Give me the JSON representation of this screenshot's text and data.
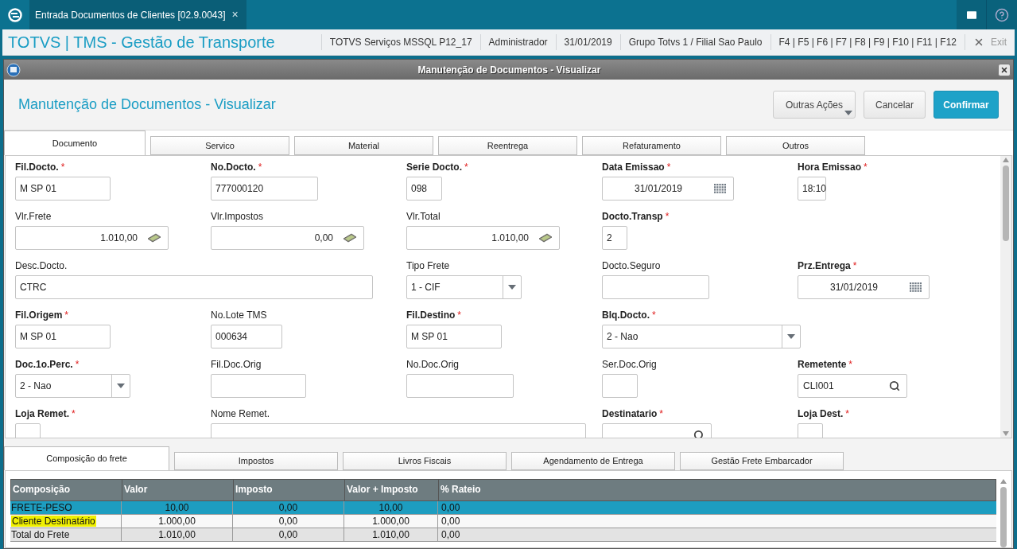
{
  "app_tab": {
    "title": "Entrada Documentos de Clientes [02.9.0043]",
    "close": "×"
  },
  "app_title": "TOTVS | TMS - Gestão de Transporte",
  "info": [
    "TOTVS Serviços MSSQL P12_17",
    "Administrador",
    "31/01/2019",
    "Grupo Totvs 1 / Filial Sao Paulo",
    "F4 | F5 | F6 | F7 | F8 | F9 | F10 | F11 | F12"
  ],
  "exit": "Exit",
  "dialog": {
    "title": "Manutenção de Documentos - Visualizar",
    "heading": "Manutenção de Documentos - Visualizar",
    "buttons": [
      {
        "label": "Outras Ações",
        "kind": "menu"
      },
      {
        "label": "Cancelar",
        "kind": "default"
      },
      {
        "label": "Confirmar",
        "kind": "primary"
      }
    ]
  },
  "tabs": [
    {
      "label": "Documento",
      "selected": true
    },
    {
      "label": "Servico",
      "selected": false
    },
    {
      "label": "Material",
      "selected": false
    },
    {
      "label": "Reentrega",
      "selected": false
    },
    {
      "label": "Refaturamento",
      "selected": false
    },
    {
      "label": "Outros",
      "selected": false
    }
  ],
  "fields": [
    {
      "label": "Fil.Docto.",
      "mark": "*",
      "value": "M SP 01",
      "kind": "text"
    },
    {
      "label": "No.Docto.",
      "mark": "*",
      "value": "777000120",
      "kind": "text"
    },
    {
      "label": "Serie Docto.",
      "mark": "*",
      "value": "098",
      "kind": "text"
    },
    {
      "label": "Data Emissao",
      "mark": "*",
      "value": "31/01/2019",
      "kind": "date"
    },
    {
      "label": "Hora Emissao",
      "mark": "*",
      "value": "18:10",
      "kind": "text"
    },
    {
      "label": "Vlr.Frete",
      "value": "1.010,00",
      "kind": "money"
    },
    {
      "label": "Vlr.Impostos",
      "value": "0,00",
      "kind": "money"
    },
    {
      "label": "Vlr.Total",
      "value": "1.010,00",
      "kind": "money"
    },
    {
      "label": "Docto.Transp",
      "mark": "*",
      "value": "2",
      "kind": "text"
    },
    {
      "label": "Desc.Docto.",
      "value": "CTRC",
      "kind": "text"
    },
    {
      "label": "Tipo Frete",
      "value": "1 - CIF",
      "kind": "select"
    },
    {
      "label": "Docto.Seguro",
      "kind": "text"
    },
    {
      "label": "Prz.Entrega",
      "mark": "*",
      "value": "31/01/2019",
      "kind": "date"
    },
    {
      "label": "Fil.Origem",
      "mark": "*",
      "value": "M SP 01",
      "kind": "text"
    },
    {
      "label": "No.Lote TMS",
      "value": "000634",
      "kind": "text"
    },
    {
      "label": "Fil.Destino",
      "mark": "*",
      "value": "M SP 01",
      "kind": "text"
    },
    {
      "label": "Blq.Docto.",
      "mark": "*",
      "value": "2 - Nao",
      "kind": "select"
    },
    {
      "label": "Doc.1o.Perc.",
      "mark": "*",
      "value": "2 - Nao",
      "kind": "select"
    },
    {
      "label": "Fil.Doc.Orig",
      "kind": "text"
    },
    {
      "label": "No.Doc.Orig",
      "kind": "text"
    },
    {
      "label": "Ser.Doc.Orig",
      "kind": "text"
    },
    {
      "label": "Remetente",
      "mark": "*",
      "value": "CLI001",
      "kind": "lookup"
    },
    {
      "label": "Loja Remet.",
      "mark": "*",
      "kind": "text"
    },
    {
      "label": "Nome Remet.",
      "kind": "text"
    },
    {
      "label": "Destinatario",
      "mark": "*",
      "kind": "lookup"
    },
    {
      "label": "Loja Dest.",
      "mark": "*",
      "kind": "text"
    }
  ],
  "bottom_tabs": [
    {
      "label": "Composição do frete",
      "selected": true
    },
    {
      "label": "Impostos",
      "selected": false
    },
    {
      "label": "Livros Fiscais",
      "selected": false
    },
    {
      "label": "Agendamento de Entrega",
      "selected": false
    },
    {
      "label": "Gestão Frete Embarcador",
      "selected": false
    }
  ],
  "table": {
    "columns": [
      "Composição",
      "Valor",
      "Imposto",
      "Valor + Imposto",
      "% Rateio"
    ],
    "rows": [
      {
        "cells": [
          "FRETE-PESO",
          "10,00",
          "0,00",
          "10,00",
          "0,00"
        ],
        "selected": true,
        "highlighted": false
      },
      {
        "cells": [
          "Cliente Destinatário",
          "1.000,00",
          "0,00",
          "1.000,00",
          "0,00"
        ],
        "selected": false,
        "highlighted": true
      },
      {
        "cells": [
          "Total do Frete",
          "1.010,00",
          "0,00",
          "1.010,00",
          "0,00"
        ],
        "selected": false,
        "highlighted": false
      }
    ]
  }
}
